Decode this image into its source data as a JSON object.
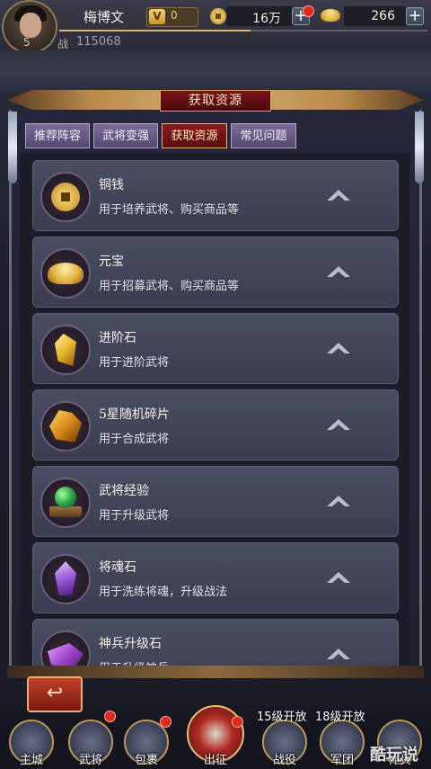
{
  "player": {
    "name": "梅博文",
    "level": "5",
    "vip_level": "0",
    "power_label": "战",
    "power": "115068",
    "xp_fraction": 0.52
  },
  "resources": {
    "coins": "16万",
    "ingots": "266"
  },
  "panel": {
    "title": "获取资源"
  },
  "tabs": [
    {
      "label": "推荐阵容",
      "active": false
    },
    {
      "label": "武将变强",
      "active": false
    },
    {
      "label": "获取资源",
      "active": true
    },
    {
      "label": "常见问题",
      "active": false
    }
  ],
  "items": [
    {
      "title": "铜钱",
      "desc": "用于培养武将、购买商品等",
      "icon": "copper-coin-icon"
    },
    {
      "title": "元宝",
      "desc": "用于招募武将、购买商品等",
      "icon": "gold-ingot-icon"
    },
    {
      "title": "进阶石",
      "desc": "用于进阶武将",
      "icon": "advance-stone-icon"
    },
    {
      "title": "5星随机碎片",
      "desc": "用于合成武将",
      "icon": "fragment-icon"
    },
    {
      "title": "武将经验",
      "desc": "用于升级武将",
      "icon": "exp-orb-icon"
    },
    {
      "title": "将魂石",
      "desc": "用于洗练将魂，升级战法",
      "icon": "soul-stone-icon"
    },
    {
      "title": "神兵升级石",
      "desc": "用于升级神兵",
      "icon": "weapon-stone-icon"
    }
  ],
  "nav": [
    {
      "label": "主城"
    },
    {
      "label": "武将"
    },
    {
      "label": "包裹"
    },
    {
      "label": "出征"
    },
    {
      "label": "战役",
      "unlock": "15级开放"
    },
    {
      "label": "军团",
      "unlock": "18级开放"
    },
    {
      "label": "神兵"
    }
  ],
  "watermark": "酷玩说",
  "colors": {
    "active_tab": "#8b1c1e",
    "tab": "#6b5d8a",
    "item_bg": "#43475b",
    "gold": "#d9b76a"
  }
}
